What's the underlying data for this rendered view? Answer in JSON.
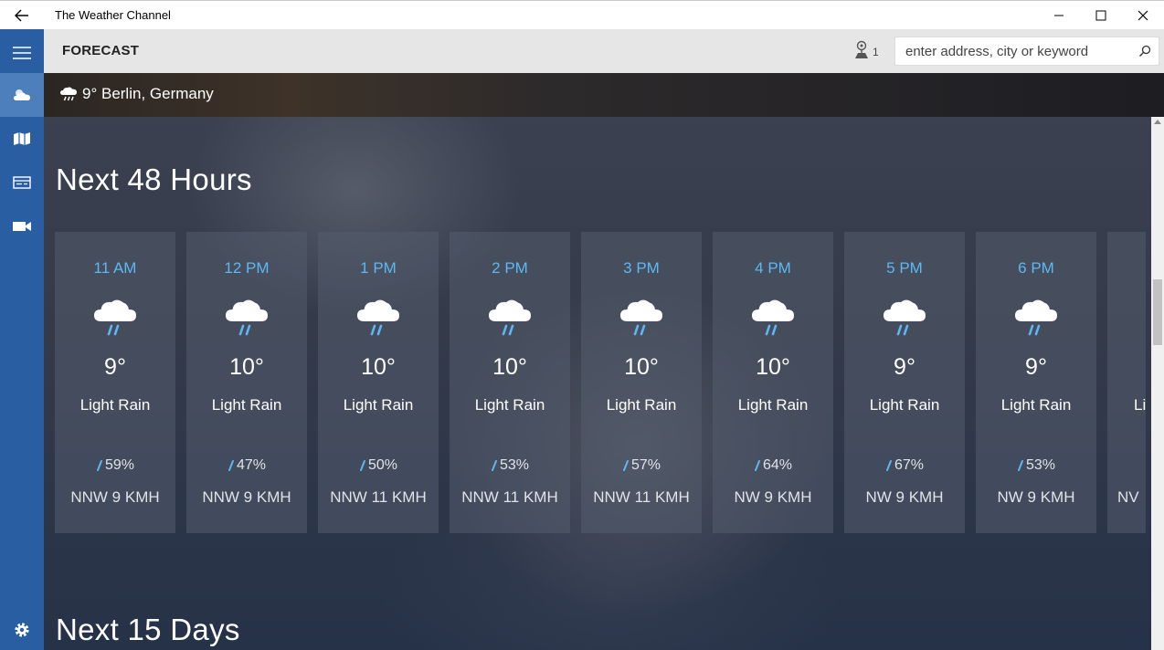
{
  "window": {
    "title": "The Weather Channel",
    "back_icon": "back-arrow-icon",
    "minimize_icon": "minimize-icon",
    "maximize_icon": "maximize-icon",
    "close_icon": "close-icon"
  },
  "nav": {
    "items": [
      {
        "name": "menu",
        "icon": "hamburger-menu-icon"
      },
      {
        "name": "forecast",
        "icon": "weather-cloud-icon",
        "active": true
      },
      {
        "name": "maps",
        "icon": "map-icon"
      },
      {
        "name": "news",
        "icon": "news-icon"
      },
      {
        "name": "video",
        "icon": "video-camera-icon"
      }
    ],
    "settings_icon": "gear-icon"
  },
  "commandbar": {
    "heading": "FORECAST",
    "location_count": "1",
    "search_placeholder": "enter address, city or keyword"
  },
  "location": {
    "icon": "rain-cloud-icon",
    "text": "9° Berlin, Germany"
  },
  "sections": {
    "hourly_title": "Next 48 Hours",
    "daily_title": "Next 15 Days"
  },
  "hourly": [
    {
      "time": "11 AM",
      "temp": "9°",
      "condition": "Light Rain",
      "precip": "59%",
      "wind": "NNW 9 KMH"
    },
    {
      "time": "12 PM",
      "temp": "10°",
      "condition": "Light Rain",
      "precip": "47%",
      "wind": "NNW 9 KMH"
    },
    {
      "time": "1 PM",
      "temp": "10°",
      "condition": "Light Rain",
      "precip": "50%",
      "wind": "NNW 11 KMH"
    },
    {
      "time": "2 PM",
      "temp": "10°",
      "condition": "Light Rain",
      "precip": "53%",
      "wind": "NNW 11 KMH"
    },
    {
      "time": "3 PM",
      "temp": "10°",
      "condition": "Light Rain",
      "precip": "57%",
      "wind": "NNW 11 KMH"
    },
    {
      "time": "4 PM",
      "temp": "10°",
      "condition": "Light Rain",
      "precip": "64%",
      "wind": "NW 9 KMH"
    },
    {
      "time": "5 PM",
      "temp": "9°",
      "condition": "Light Rain",
      "precip": "67%",
      "wind": "NW 9 KMH"
    },
    {
      "time": "6 PM",
      "temp": "9°",
      "condition": "Light Rain",
      "precip": "53%",
      "wind": "NW 9 KMH"
    },
    {
      "time": "",
      "temp": "",
      "condition": "Li",
      "precip": "",
      "wind": "NV"
    }
  ],
  "colors": {
    "accent": "#2a5ea3",
    "time_label": "#5cb8f2",
    "rain_drop": "#5cb8f2"
  }
}
